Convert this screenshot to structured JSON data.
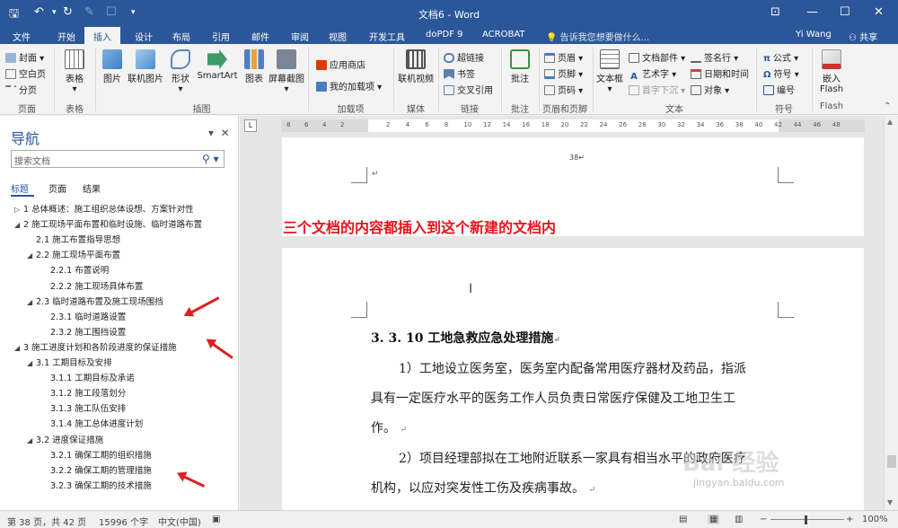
{
  "window": {
    "title": "文档6 - Word"
  },
  "menu_tabs": [
    "文件",
    "开始",
    "插入",
    "设计",
    "布局",
    "引用",
    "邮件",
    "审阅",
    "视图",
    "开发工具",
    "doPDF 9",
    "ACROBAT"
  ],
  "active_tab": "插入",
  "tell_me": "告诉我您想要做什么...",
  "user": "Yi Wang",
  "share": "共享",
  "ribbon": {
    "pages": {
      "cover": "封面",
      "blank": "空白页",
      "break": "分页",
      "group": "页面"
    },
    "table": {
      "label": "表格",
      "group": "表格"
    },
    "illustrations": {
      "picture": "图片",
      "online_picture": "联机图片",
      "shapes": "形状",
      "smartart": "SmartArt",
      "chart": "图表",
      "screenshot": "屏幕截图",
      "group": "插图"
    },
    "addins": {
      "store": "应用商店",
      "my_addins": "我的加载项",
      "group": "加载项"
    },
    "media": {
      "online_video": "联机视频",
      "group": "媒体"
    },
    "links": {
      "hyperlink": "超链接",
      "bookmark": "书签",
      "cross_ref": "交叉引用",
      "group": "链接"
    },
    "comments": {
      "comment": "批注",
      "group": "批注"
    },
    "header_footer": {
      "header": "页眉",
      "footer": "页脚",
      "page_number": "页码",
      "group": "页眉和页脚"
    },
    "text": {
      "textbox": "文本框",
      "quick_parts": "文档部件",
      "wordart": "艺术字",
      "dropcap": "首字下沉",
      "signature": "签名行",
      "datetime": "日期和时间",
      "object": "对象",
      "group": "文本"
    },
    "symbols": {
      "equation": "公式",
      "symbol": "符号",
      "numbering": "编号",
      "group": "符号"
    },
    "flash": {
      "embed": "嵌入",
      "flash": "Flash",
      "group": "Flash"
    }
  },
  "nav": {
    "title": "导航",
    "search_placeholder": "搜索文档",
    "tabs": [
      "标题",
      "页面",
      "结果"
    ],
    "tree": [
      {
        "text": "1 总体概述：施工组织总体设想、方案针对性",
        "level": 0,
        "toggle": "▷"
      },
      {
        "text": "2 施工现场平面布置和临时设施、临时道路布置",
        "level": 0,
        "toggle": "◢"
      },
      {
        "text": "2.1 施工布置指导思想",
        "level": 1,
        "toggle": ""
      },
      {
        "text": "2.2 施工现场平面布置",
        "level": 1,
        "toggle": "◢"
      },
      {
        "text": "2.2.1 布置说明",
        "level": 2,
        "toggle": ""
      },
      {
        "text": "2.2.2 施工现场具体布置",
        "level": 2,
        "toggle": ""
      },
      {
        "text": "2.3 临时道路布置及施工现场围挡",
        "level": 1,
        "toggle": "◢"
      },
      {
        "text": "2.3.1 临时道路设置",
        "level": 2,
        "toggle": ""
      },
      {
        "text": "2.3.2 施工围挡设置",
        "level": 2,
        "toggle": ""
      },
      {
        "text": "3 施工进度计划和各阶段进度的保证措施",
        "level": 0,
        "toggle": "◢"
      },
      {
        "text": "3.1 工期目标及安排",
        "level": 1,
        "toggle": "◢"
      },
      {
        "text": "3.1.1 工期目标及承诺",
        "level": 2,
        "toggle": ""
      },
      {
        "text": "3.1.2 施工段落划分",
        "level": 2,
        "toggle": ""
      },
      {
        "text": "3.1.3 施工队伍安排",
        "level": 2,
        "toggle": ""
      },
      {
        "text": "3.1.4 施工总体进度计划",
        "level": 2,
        "toggle": ""
      },
      {
        "text": "3.2 进度保证措施",
        "level": 1,
        "toggle": "◢"
      },
      {
        "text": "3.2.1 确保工期的组织措施",
        "level": 2,
        "toggle": ""
      },
      {
        "text": "3.2.2 确保工期的管理措施",
        "level": 2,
        "toggle": ""
      },
      {
        "text": "3.2.3 确保工期的技术措施",
        "level": 2,
        "toggle": ""
      }
    ]
  },
  "ruler": {
    "left": [
      "8",
      "6",
      "4",
      "2"
    ],
    "right": [
      "2",
      "4",
      "6",
      "8",
      "10",
      "12",
      "14",
      "16",
      "18",
      "20",
      "22",
      "24",
      "26",
      "28",
      "30",
      "32",
      "34",
      "36",
      "38",
      "40",
      "42",
      "44",
      "46",
      "48"
    ]
  },
  "doc": {
    "page_number": "38",
    "caption": "三个文档的内容都插入到这个新建的文档内",
    "heading": "3. 3. 10 工地急救应急处理措施",
    "lines": [
      "1）工地设立医务室，医务室内配备常用医疗器材及药品，指派",
      "具有一定医疗水平的医务工作人员负责日常医疗保健及工地卫生工",
      "作。",
      "2）项目经理部拟在工地附近联系一家具有相当水平的政府医疗",
      "机构，以应对突发性工伤及疾病事故。"
    ]
  },
  "status": {
    "page": "第 38 页，共 42 页",
    "words": "15996 个字",
    "language": "中文(中国)",
    "zoom": "100%"
  },
  "watermark": {
    "text": "Bai 经验",
    "url": "jingyan.baidu.com"
  },
  "colors": {
    "accent": "#2b579a",
    "annotation": "#e8141b"
  }
}
